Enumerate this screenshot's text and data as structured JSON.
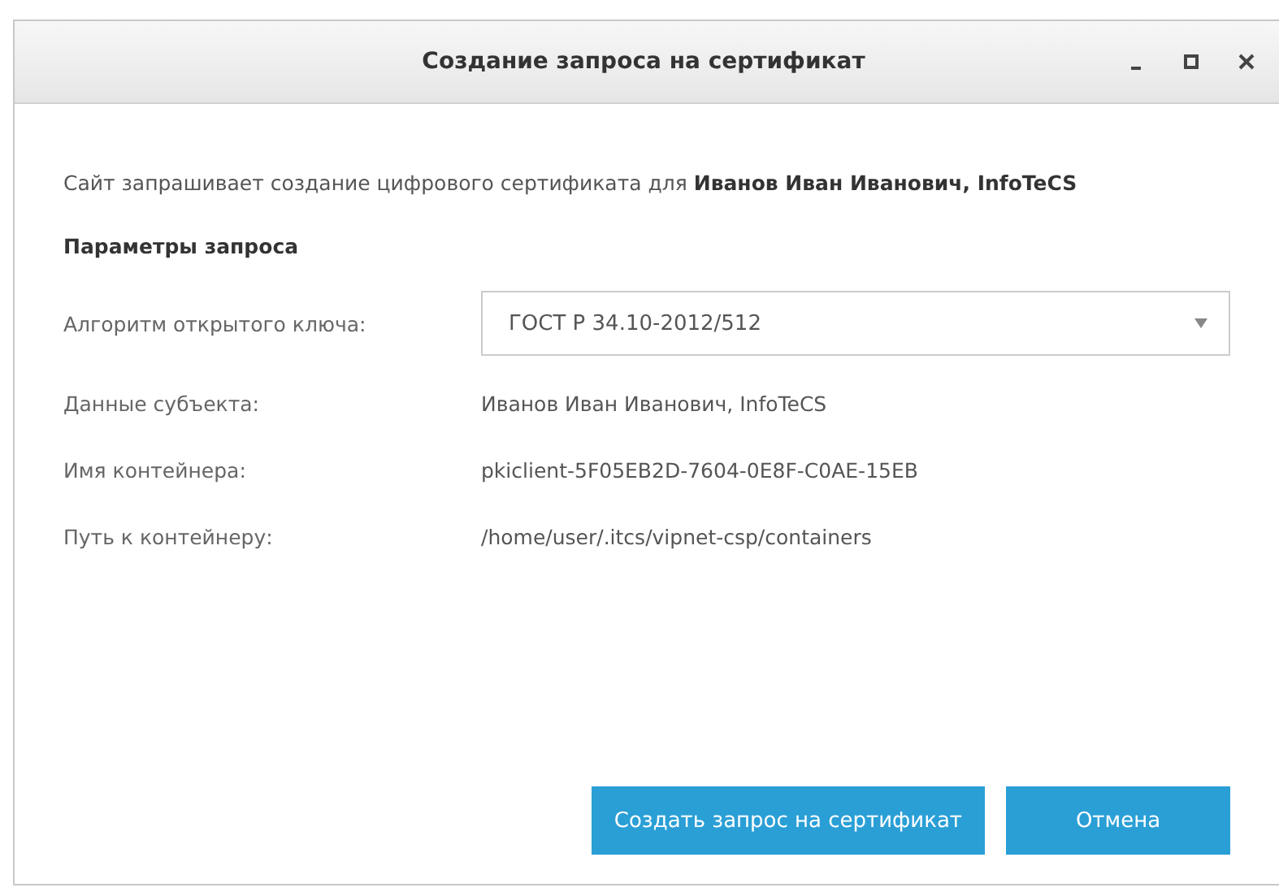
{
  "window": {
    "title": "Создание запроса на сертификат"
  },
  "intro": "Сайт запрашивает создание цифрового сертификата для **Иванов Иван Иванович, InfoTeCS**",
  "section_title": "Параметры запроса",
  "algorithm": {
    "label": "Алгоритм открытого ключа:",
    "value": "ГОСТ Р 34.10-2012/512"
  },
  "fields": [
    {
      "label": "Данные субъекта:",
      "value": "Иванов Иван Иванович, InfoTeCS"
    },
    {
      "label": "Имя контейнера:",
      "value": "pkiclient-5F05EB2D-7604-0E8F-C0AE-15EB"
    },
    {
      "label": "Путь к контейнеру:",
      "value": "/home/user/.itcs/vipnet-csp/containers"
    }
  ],
  "buttons": [
    {
      "label": "Создать запрос на сертификат",
      "kind": "primary"
    },
    {
      "label": "Отмена",
      "kind": "primary"
    }
  ]
}
